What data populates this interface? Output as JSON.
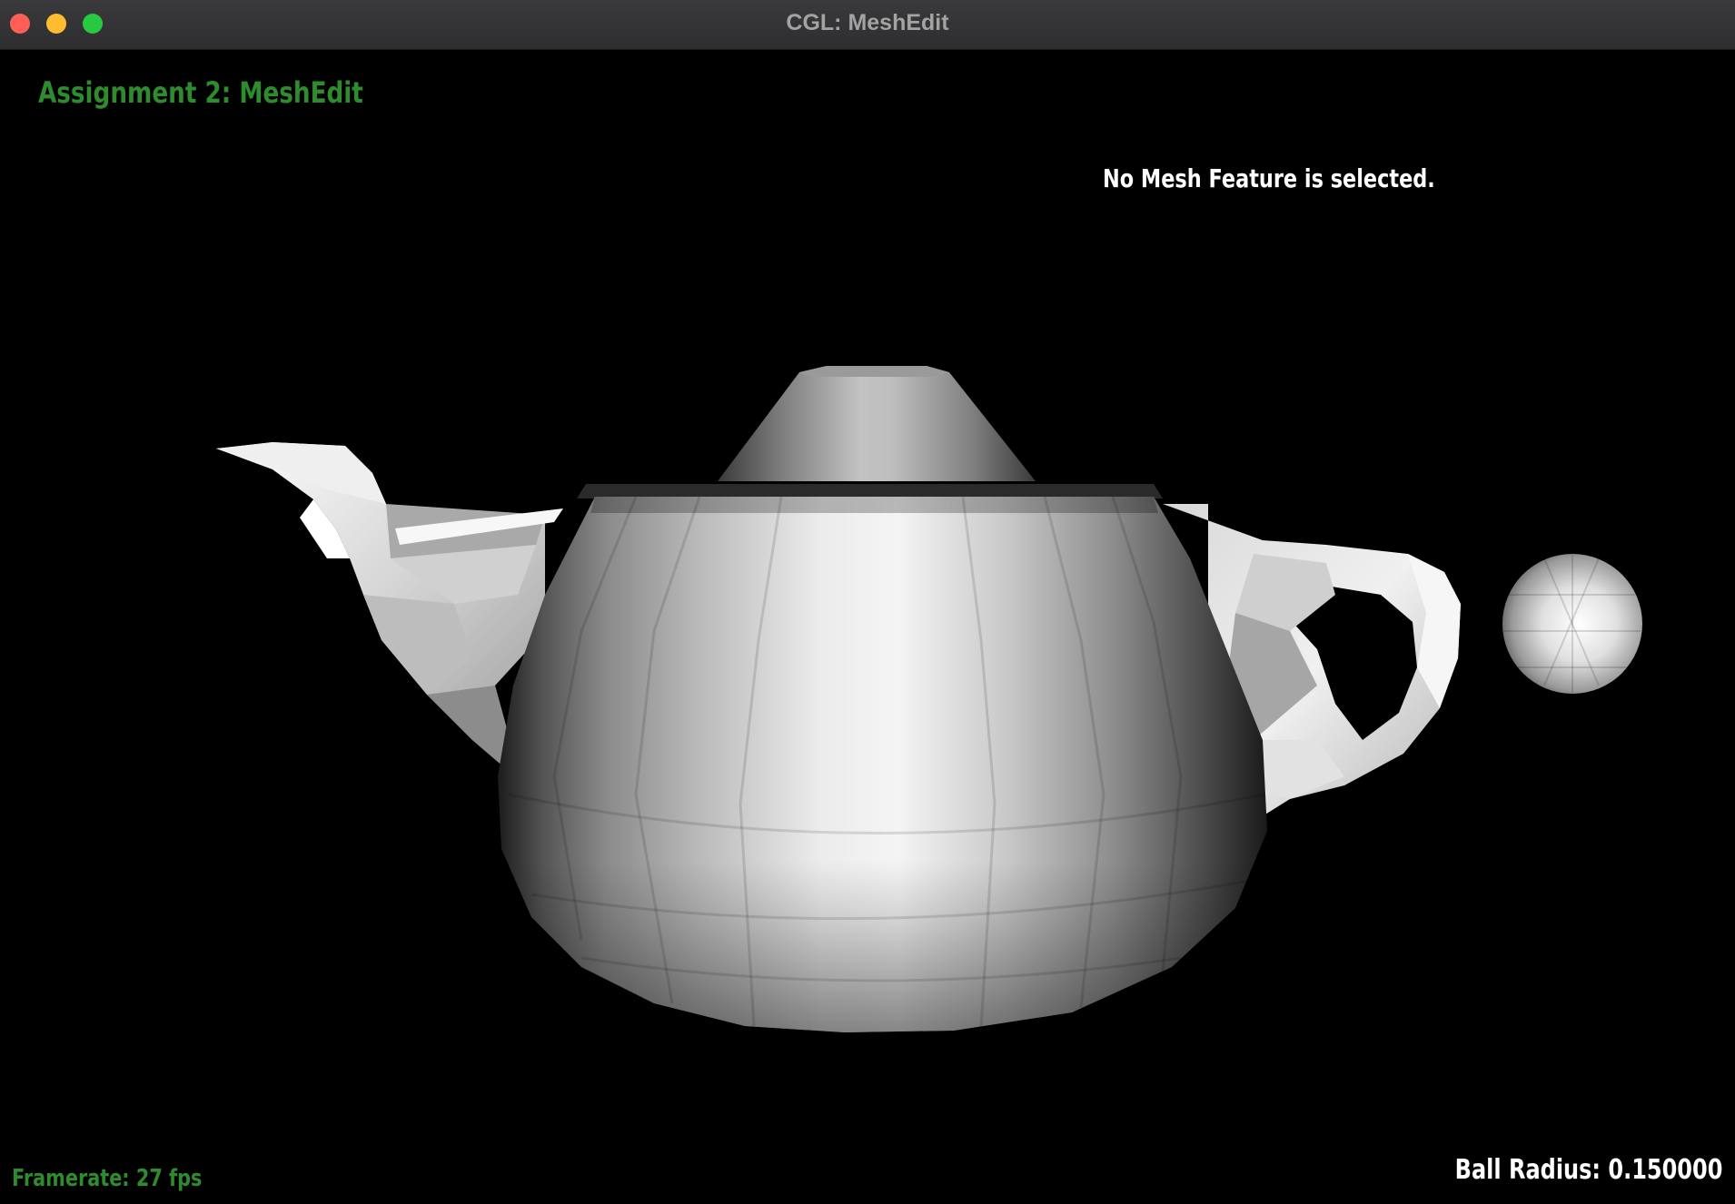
{
  "window": {
    "title": "CGL: MeshEdit"
  },
  "hud": {
    "title": "Assignment 2: MeshEdit",
    "status": "No Mesh Feature is selected.",
    "framerate": "Framerate: 27 fps",
    "ball_radius": "Ball Radius: 0.150000"
  },
  "colors": {
    "hud_green": "#2e8b2e",
    "hud_white": "#ffffff",
    "background": "#000000"
  },
  "scene": {
    "objects": [
      "teapot-mesh",
      "ball-sphere"
    ]
  }
}
